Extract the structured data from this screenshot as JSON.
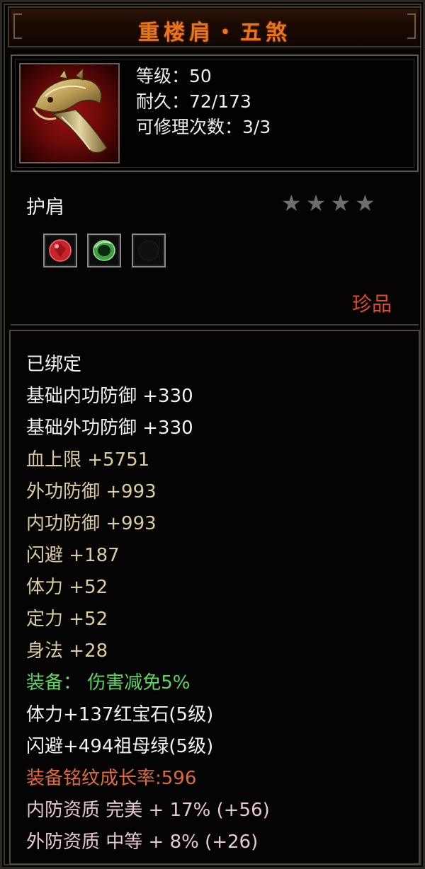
{
  "item": {
    "name": "重楼肩・五煞",
    "level": "等级：50",
    "durability": "耐久：72/173",
    "repairs": "可修理次数：3/3",
    "type": "护肩",
    "stars": 4,
    "rarity": "珍品",
    "icon": "shoulder-armor-icon"
  },
  "gems": [
    {
      "name": "ruby-gem-icon",
      "color": "#c9232b"
    },
    {
      "name": "emerald-gem-icon",
      "color": "#3fa043"
    },
    {
      "name": "empty-socket-icon",
      "color": "#111111"
    }
  ],
  "properties": {
    "bound": "已绑定",
    "base_inner_def": "基础内功防御  +330",
    "base_outer_def": "基础外功防御  +330",
    "hp": "血上限  +5751",
    "outer_def": "外功防御  +993",
    "inner_def": "内功防御  +993",
    "dodge": "闪避  +187",
    "stamina": "体力  +52",
    "focus": "定力  +52",
    "agility": "身法  +28",
    "equip_effect": "装备：  伤害减免5%",
    "gem1": "体力+137红宝石(5级)",
    "gem2": "闪避+494祖母绿(5级)",
    "growth": "装备铭纹成长率:596",
    "inner_quality": "内防资质  完美  +  17%  (+56)",
    "outer_quality": "外防资质  中等  +  8%  (+26)"
  },
  "colors": {
    "title": "#e8751a",
    "rarity": "#e04a2a",
    "stat_tan": "#dccb9c",
    "equip_green": "#5cd65c",
    "growth_orange": "#e06a3a",
    "quality_pink": "#e8c7d4"
  }
}
